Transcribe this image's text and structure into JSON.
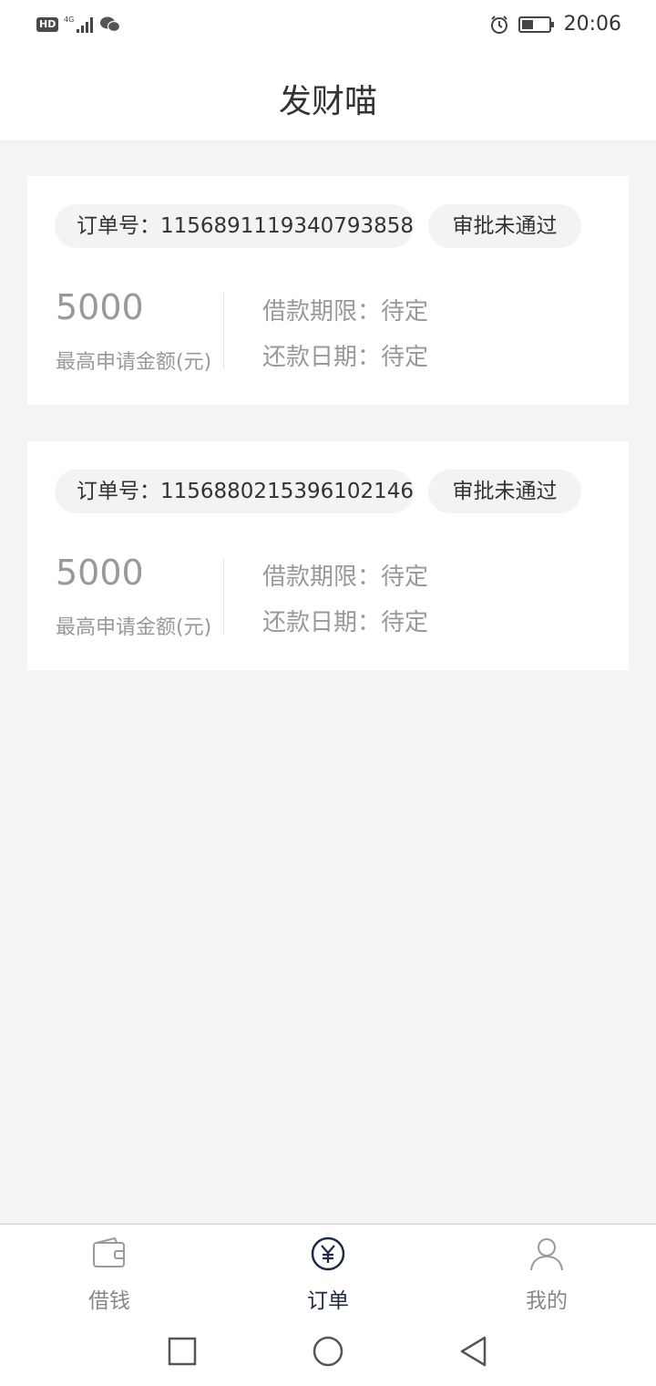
{
  "status_bar": {
    "network_badge": "HD",
    "signal_label": "4G",
    "time": "20:06",
    "icons": [
      "hd-icon",
      "signal-4g-icon",
      "wechat-icon",
      "alarm-icon",
      "battery-icon"
    ]
  },
  "header": {
    "title": "发财喵"
  },
  "orders": [
    {
      "order_no": "订单号：115689111934079385​8",
      "status": "审批未通过",
      "amount": "5000",
      "amount_label": "最高申请金额(元)",
      "term": "借款期限：待定",
      "repay_date": "还款日期：待定"
    },
    {
      "order_no": "订单号：1156880215396102146",
      "status": "审批未通过",
      "amount": "5000",
      "amount_label": "最高申请金额(元)",
      "term": "借款期限：待定",
      "repay_date": "还款日期：待定"
    }
  ],
  "tabbar": {
    "items": [
      {
        "label": "借钱",
        "icon": "wallet-icon",
        "active": false
      },
      {
        "label": "订单",
        "icon": "yuan-icon",
        "active": true
      },
      {
        "label": "我的",
        "icon": "user-icon",
        "active": false
      }
    ]
  },
  "colors": {
    "background": "#f4f4f4",
    "card": "#ffffff",
    "pill": "#f3f3f3",
    "muted_text": "#999999",
    "active_tab": "#1f2a44"
  }
}
